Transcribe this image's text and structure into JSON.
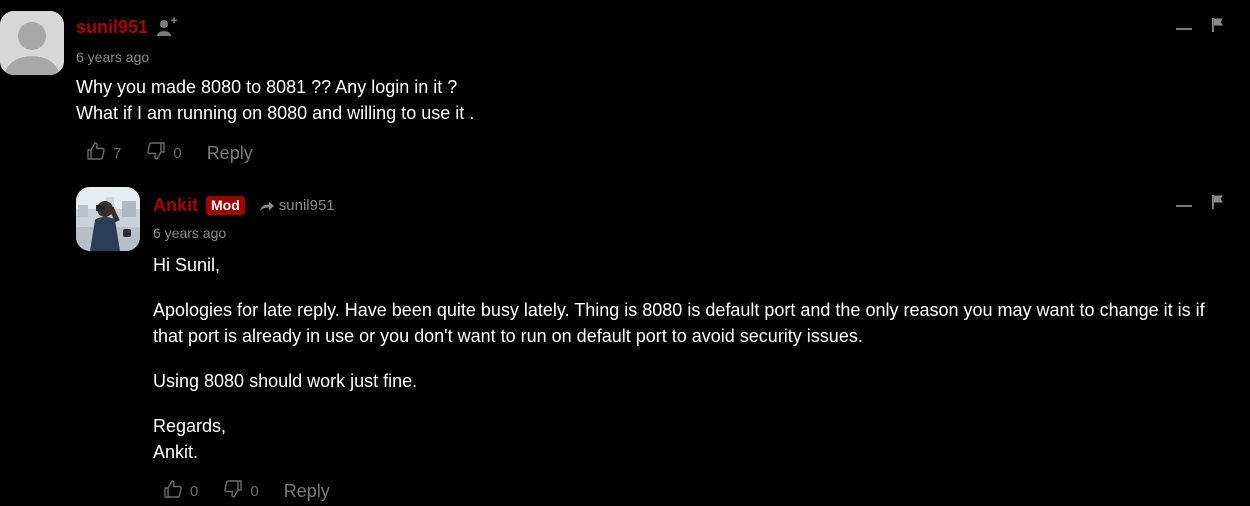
{
  "comments": [
    {
      "author": "sunil951",
      "time": "6 years ago",
      "body": [
        "Why you made 8080 to 8081 ?? Any login in it ?",
        "What if I am running on 8080 and willing to use it ."
      ],
      "upvotes": "7",
      "downvotes": "0",
      "reply_label": "Reply",
      "icons": {
        "follow": "add-user-icon",
        "collapse": "minus-icon",
        "flag": "flag-icon"
      }
    },
    {
      "author": "Ankit",
      "badge": "Mod",
      "in_reply_to": "sunil951",
      "time": "6 years ago",
      "body": [
        "Hi Sunil,",
        "Apologies for late reply. Have been quite busy lately. Thing is 8080 is default port and the only reason you may want to change it is if",
        "that port is already in use or you don't want to run on default port to avoid security issues.",
        "Using 8080 should work just fine.",
        "Regards,",
        "Ankit."
      ],
      "upvotes": "0",
      "downvotes": "0",
      "reply_label": "Reply",
      "icons": {
        "reply_arrow": "reply-arrow-icon",
        "collapse": "minus-icon",
        "flag": "flag-icon"
      }
    }
  ],
  "colors": {
    "background": "#000000",
    "author": "#b10000",
    "mod_badge": "#a40000",
    "muted": "#8a8a8a"
  }
}
